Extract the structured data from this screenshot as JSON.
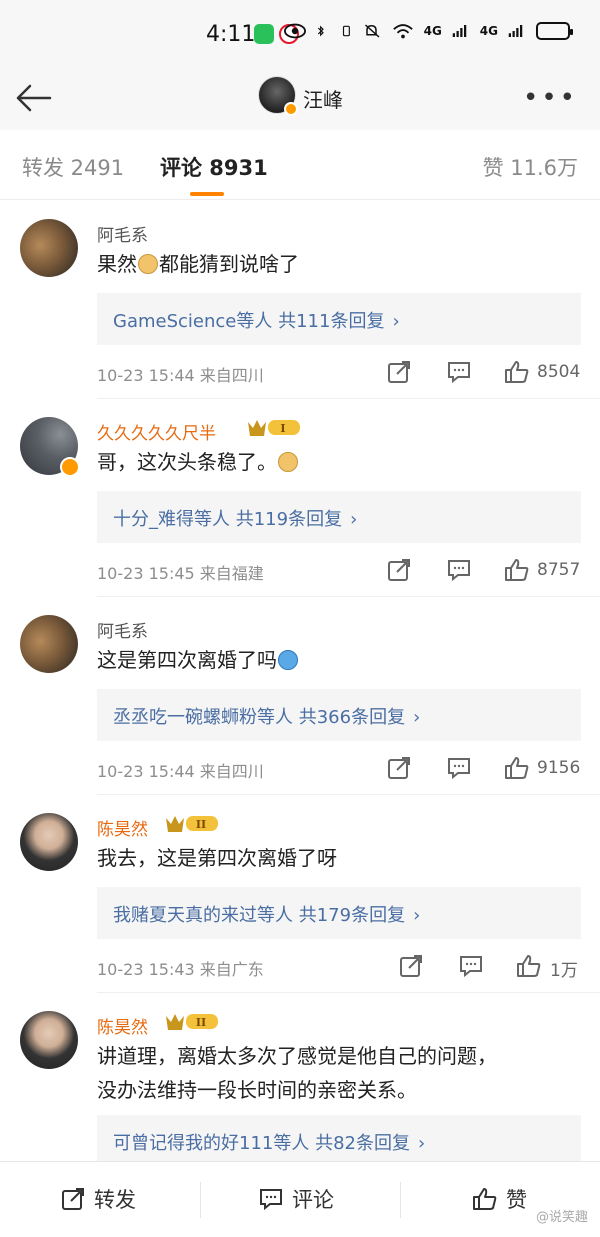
{
  "status_bar": {
    "time": "4:11",
    "network_labels": [
      "4G",
      "4G"
    ],
    "icons": [
      "wechat-icon",
      "weibo-icon",
      "eye-icon",
      "bluetooth-icon",
      "vibrate-icon",
      "mute-icon",
      "wifi-icon",
      "signal-icon",
      "signal-icon",
      "battery-icon"
    ]
  },
  "nav": {
    "title": "汪峰",
    "more": "•••"
  },
  "tabs": {
    "repost": "转发 2491",
    "comment": "评论 8931",
    "like": "赞 11.6万"
  },
  "comments": [
    {
      "name": "阿毛系",
      "vip": false,
      "text_before": "果然",
      "text_after": "都能猜到说啥了",
      "emoji": "doge",
      "replies": "GameScience等人  共111条回复",
      "meta": "10-23 15:44  来自四川",
      "likes": "8504"
    },
    {
      "name": "久久久久久尺半",
      "vip": true,
      "vip_level": "I",
      "text_before": "哥，这次头条稳了。",
      "text_after": "",
      "emoji": "doge",
      "replies": "十分_难得等人  共119条回复",
      "meta": "10-23 15:45  来自福建",
      "likes": "8757"
    },
    {
      "name": "阿毛系",
      "vip": false,
      "text_before": "这是第四次离婚了吗",
      "text_after": "",
      "emoji": "blue",
      "replies": "丞丞吃一碗螺蛳粉等人  共366条回复",
      "meta": "10-23 15:44  来自四川",
      "likes": "9156"
    },
    {
      "name": "陈昊然",
      "vip": true,
      "vip_level": "II",
      "text_before": "我去，这是第四次离婚了呀",
      "text_after": "",
      "emoji": "",
      "replies": "我赌夏天真的来过等人  共179条回复",
      "meta": "10-23 15:43  来自广东",
      "likes": "1万"
    },
    {
      "name": "陈昊然",
      "vip": true,
      "vip_level": "II",
      "text_before": "讲道理，离婚太多次了感觉是他自己的问题，",
      "text_line2": "没办法维持一段长时间的亲密关系。",
      "replies": "可曾记得我的好111等人  共82条回复"
    }
  ],
  "bottom_bar": {
    "repost": "转发",
    "comment": "评论",
    "like": "赞",
    "watermark": "@说笑趣"
  },
  "colors": {
    "accent": "#ff8200",
    "link": "#4a6ea3",
    "vip_name": "#e86a10"
  }
}
